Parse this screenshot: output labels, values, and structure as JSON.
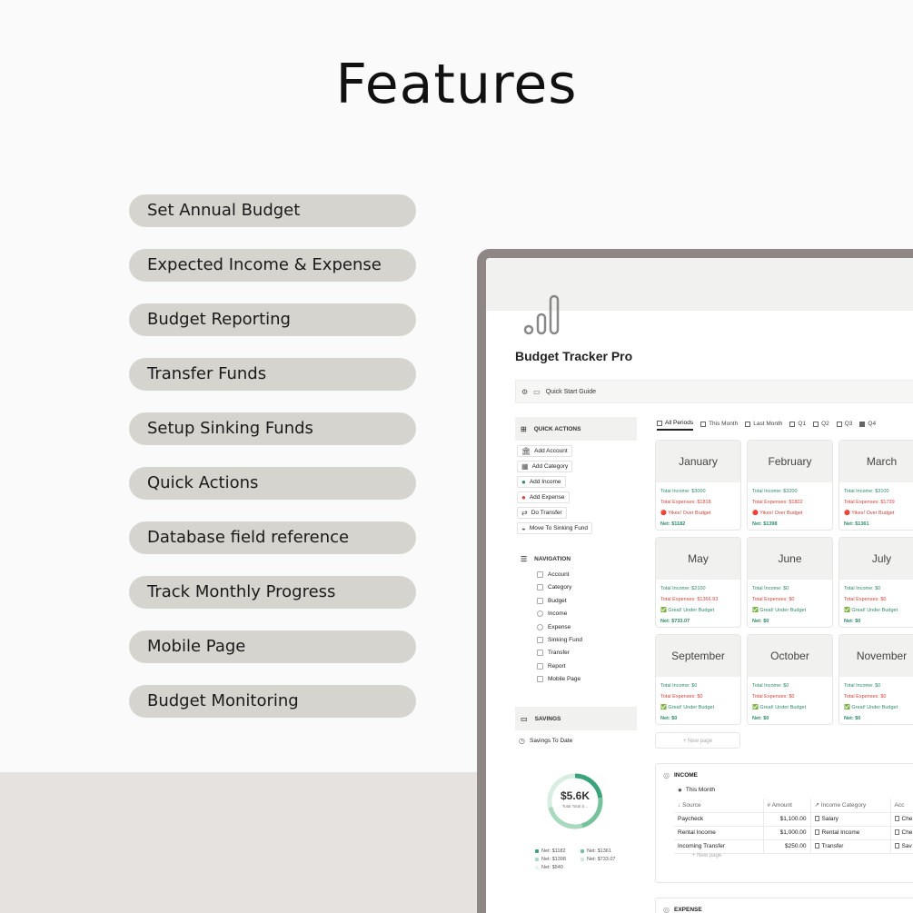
{
  "hero": {
    "title": "Features"
  },
  "features": [
    "Set Annual Budget",
    "Expected Income & Expense",
    "Budget Reporting",
    "Transfer Funds",
    "Setup Sinking Funds",
    "Quick Actions",
    "Database field reference",
    "Track Monthly Progress",
    "Mobile Page",
    "Budget Monitoring"
  ],
  "app": {
    "page_title": "Budget Tracker Pro",
    "quick_start": "Quick Start Guide",
    "quick_actions": {
      "title": "QUICK ACTIONS",
      "buttons": [
        "Add Account",
        "Add Category",
        "Add Income",
        "Add Expense",
        "Do Transfer",
        "Move To Sinking Fund"
      ]
    },
    "navigation": {
      "title": "NAVIGATION",
      "items": [
        "Account",
        "Category",
        "Budget",
        "Income",
        "Expense",
        "Sinking Fund",
        "Transfer",
        "Report",
        "Mobile Page"
      ]
    },
    "savings": {
      "title": "SAVINGS",
      "view": "Savings To Date",
      "total": "$5.6K",
      "total_label": "Total Total S...",
      "legend": [
        {
          "label": "Net: $1182",
          "color": "#3aa37a"
        },
        {
          "label": "Net: $1361",
          "color": "#76c29d"
        },
        {
          "label": "Net: $1398",
          "color": "#a9d9bf"
        },
        {
          "label": "Net: $733.07",
          "color": "#cdebdb"
        },
        {
          "label": "Net: $940",
          "color": "#e5f4ec"
        }
      ]
    },
    "tabs": [
      "All Periods",
      "This Month",
      "Last Month",
      "Q1",
      "Q2",
      "Q3",
      "Q4"
    ],
    "months": [
      {
        "name": "January",
        "income": "Total Income: $3000",
        "expenses": "Total Expenses: $1818",
        "status": "🔴 Yikes! Over Budget",
        "good": false,
        "net": "Net: $1182"
      },
      {
        "name": "February",
        "income": "Total Income: $3200",
        "expenses": "Total Expenses: $1802",
        "status": "🔴 Yikes! Over Budget",
        "good": false,
        "net": "Net: $1398"
      },
      {
        "name": "March",
        "income": "Total Income: $3100",
        "expenses": "Total Expenses: $1739",
        "status": "🔴 Yikes! Over Budget",
        "good": false,
        "net": "Net: $1361"
      },
      {
        "name": "May",
        "income": "Total Income: $2100",
        "expenses": "Total Expenses: $1366.93",
        "status": "✅ Great! Under Budget",
        "good": true,
        "net": "Net: $733.07"
      },
      {
        "name": "June",
        "income": "Total Income: $0",
        "expenses": "Total Expenses: $0",
        "status": "✅ Great! Under Budget",
        "good": true,
        "net": "Net: $0"
      },
      {
        "name": "July",
        "income": "Total Income: $0",
        "expenses": "Total Expenses: $0",
        "status": "✅ Great! Under Budget",
        "good": true,
        "net": "Net: $0"
      },
      {
        "name": "September",
        "income": "Total Income: $0",
        "expenses": "Total Expenses: $0",
        "status": "✅ Great! Under Budget",
        "good": true,
        "net": "Net: $0"
      },
      {
        "name": "October",
        "income": "Total Income: $0",
        "expenses": "Total Expenses: $0",
        "status": "✅ Great! Under Budget",
        "good": true,
        "net": "Net: $0"
      },
      {
        "name": "November",
        "income": "Total Income: $0",
        "expenses": "Total Expenses: $0",
        "status": "✅ Great! Under Budget",
        "good": true,
        "net": "Net: $0"
      }
    ],
    "new_page": "+ New page",
    "income": {
      "title": "INCOME",
      "view": "This Month",
      "columns": [
        "Source",
        "Amount",
        "Income Category",
        "Acc"
      ],
      "rows": [
        [
          "Paycheck",
          "$1,100.00",
          "Salary",
          "Che"
        ],
        [
          "Rental Income",
          "$1,000.00",
          "Rental Income",
          "Che"
        ],
        [
          "Incoming Transfer",
          "$250.00",
          "Transfer",
          "Sav"
        ]
      ],
      "new_row": "+ New page"
    },
    "expense": {
      "title": "EXPENSE"
    }
  }
}
